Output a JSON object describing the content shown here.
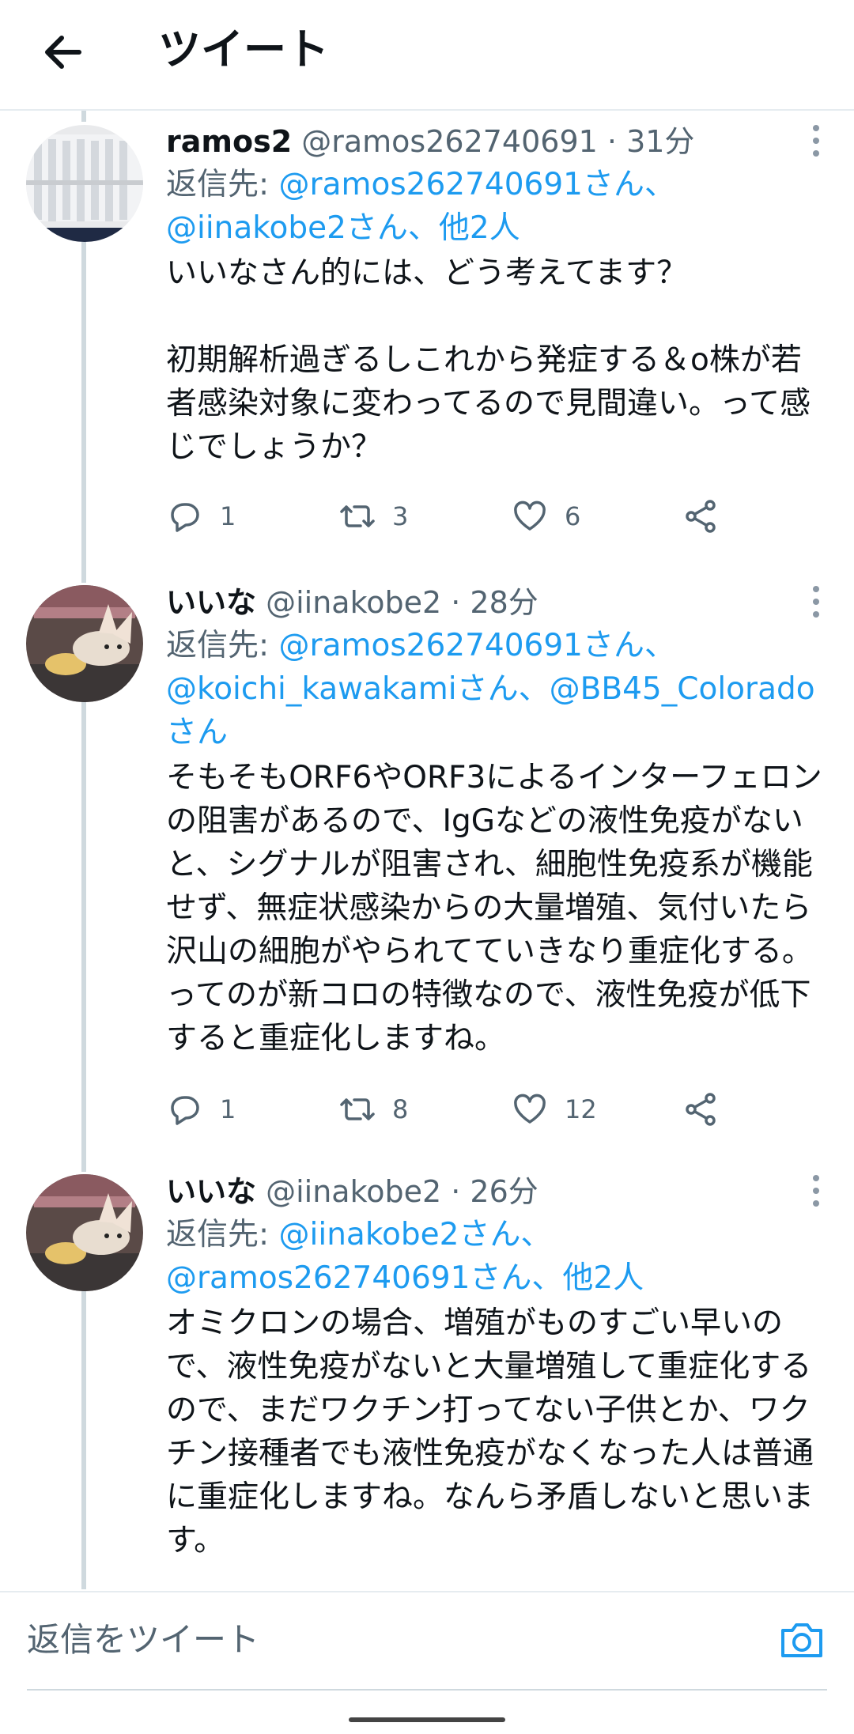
{
  "header": {
    "title": "ツイート",
    "back_icon": "arrow-left-icon"
  },
  "tweets": [
    {
      "name": "ramos2",
      "handle": "@ramos262740691",
      "time": "· 31分",
      "reply_prefix": "返信先: ",
      "reply_targets": "@ramos262740691さん、@iinakobe2さん、他2人",
      "text": "いいなさん的には、どう考えてます？\n\n初期解析過ぎるしこれから発症する＆o株が若者感染対象に変わってるので見間違い。って感じでしょうか？",
      "replies": "1",
      "retweets": "3",
      "likes": "6"
    },
    {
      "name": "いいな",
      "handle": "@iinakobe2",
      "time": "· 28分",
      "reply_prefix": "返信先: ",
      "reply_targets": "@ramos262740691さん、@koichi_kawakamiさん、@BB45_Coloradoさん",
      "text": "そもそもORF6やORF3によるインターフェロンの阻害があるので、IgGなどの液性免疫がないと、シグナルが阻害され、細胞性免疫系が機能せず、無症状感染からの大量増殖、気付いたら沢山の細胞がやられてていきなり重症化する。ってのが新コロの特徴なので、液性免疫が低下すると重症化しますね。",
      "replies": "1",
      "retweets": "8",
      "likes": "12"
    },
    {
      "name": "いいな",
      "handle": "@iinakobe2",
      "time": "· 26分",
      "reply_prefix": "返信先: ",
      "reply_targets": "@iinakobe2さん、@ramos262740691さん、他2人",
      "text": "オミクロンの場合、増殖がものすごい早いので、液性免疫がないと大量増殖して重症化するので、まだワクチン打ってない子供とか、ワクチン接種者でも液性免疫がなくなった人は普通に重症化しますね。なんら矛盾しないと思います。"
    }
  ],
  "reply_bar": {
    "placeholder": "返信をツイート",
    "camera_icon": "camera-icon"
  },
  "colors": {
    "link": "#1d9bf0",
    "secondary_text": "#536471",
    "thread_line": "#cfd9de"
  }
}
